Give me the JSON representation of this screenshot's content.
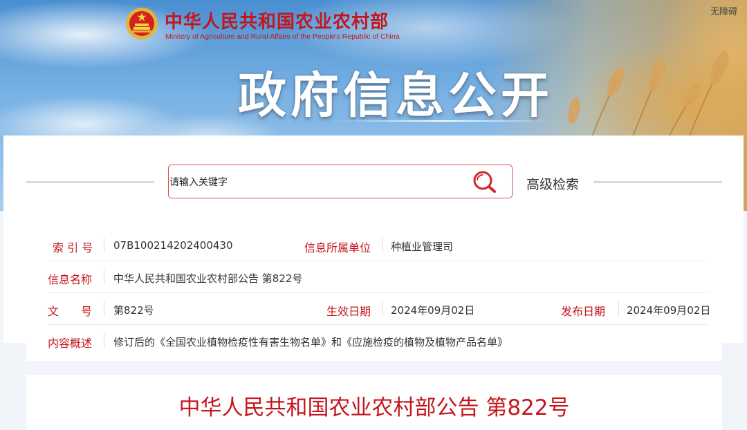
{
  "header": {
    "ministry_name_cn": "中华人民共和国农业农村部",
    "ministry_name_en": "Ministry of Agriculture and Rural Affairs of the People's Republic of China",
    "accessibility_link": "无障碍",
    "banner_title": "政府信息公开",
    "emblem_icon": "national-emblem-icon"
  },
  "search": {
    "placeholder": "请输入关键字",
    "search_icon": "search-icon",
    "advanced_label": "高级检索"
  },
  "info": {
    "index_label": "索 引 号",
    "index_value": "07B100214202400430",
    "unit_label": "信息所属单位",
    "unit_value": "种植业管理司",
    "name_label": "信息名称",
    "name_value": "中华人民共和国农业农村部公告 第822号",
    "docno_label": "文　　号",
    "docno_value": "第822号",
    "effective_label": "生效日期",
    "effective_value": "2024年09月02日",
    "publish_label": "发布日期",
    "publish_value": "2024年09月02日",
    "summary_label": "内容概述",
    "summary_value": "修订后的《全国农业植物检疫性有害生物名单》和《应施检疫的植物及植物产品名单》"
  },
  "document": {
    "title": "中华人民共和国农业农村部公告 第822号"
  },
  "colors": {
    "accent_red": "#c4161c",
    "text": "#333333",
    "sky_blue": "#79b2e4"
  }
}
